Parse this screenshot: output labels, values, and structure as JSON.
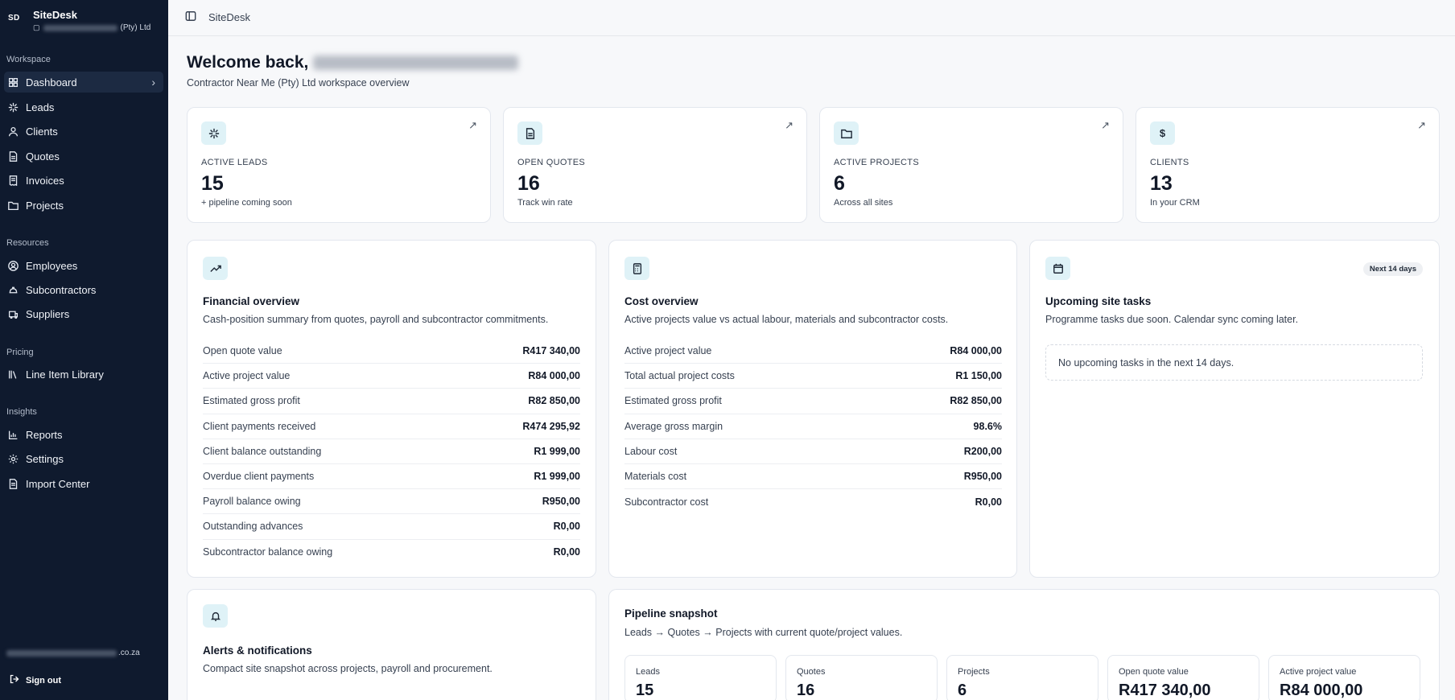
{
  "sidebar": {
    "badge": "SD",
    "app_name": "SiteDesk",
    "company_suffix": "(Pty) Ltd",
    "sections": {
      "workspace": "Workspace",
      "resources": "Resources",
      "pricing": "Pricing",
      "insights": "Insights"
    },
    "items": [
      {
        "label": "Dashboard",
        "icon": "grid-icon"
      },
      {
        "label": "Leads",
        "icon": "sparkle-icon"
      },
      {
        "label": "Clients",
        "icon": "user-icon"
      },
      {
        "label": "Quotes",
        "icon": "document-icon"
      },
      {
        "label": "Invoices",
        "icon": "receipt-icon"
      },
      {
        "label": "Projects",
        "icon": "folder-icon"
      },
      {
        "label": "Employees",
        "icon": "user-circle-icon"
      },
      {
        "label": "Subcontractors",
        "icon": "hardhat-icon"
      },
      {
        "label": "Suppliers",
        "icon": "package-icon"
      },
      {
        "label": "Line Item Library",
        "icon": "library-icon"
      },
      {
        "label": "Reports",
        "icon": "bar-chart-icon"
      },
      {
        "label": "Settings",
        "icon": "gear-icon"
      },
      {
        "label": "Import Center",
        "icon": "import-icon"
      }
    ],
    "email_suffix": ".co.za",
    "signout": "Sign out"
  },
  "topbar": {
    "title": "SiteDesk"
  },
  "header": {
    "welcome": "Welcome back,",
    "subtitle": "Contractor Near Me (Pty) Ltd workspace overview"
  },
  "stats": [
    {
      "label": "ACTIVE LEADS",
      "value": "15",
      "note": "+ pipeline coming soon",
      "icon": "sparkle-icon"
    },
    {
      "label": "OPEN QUOTES",
      "value": "16",
      "note": "Track win rate",
      "icon": "document-icon"
    },
    {
      "label": "ACTIVE PROJECTS",
      "value": "6",
      "note": "Across all sites",
      "icon": "folder-icon"
    },
    {
      "label": "CLIENTS",
      "value": "13",
      "note": "In your CRM",
      "icon": "dollar-icon"
    }
  ],
  "financial": {
    "title": "Financial overview",
    "desc": "Cash-position summary from quotes, payroll and subcontractor commitments.",
    "rows": [
      {
        "label": "Open quote value",
        "value": "R417 340,00"
      },
      {
        "label": "Active project value",
        "value": "R84 000,00"
      },
      {
        "label": "Estimated gross profit",
        "value": "R82 850,00"
      },
      {
        "label": "Client payments received",
        "value": "R474 295,92"
      },
      {
        "label": "Client balance outstanding",
        "value": "R1 999,00"
      },
      {
        "label": "Overdue client payments",
        "value": "R1 999,00"
      },
      {
        "label": "Payroll balance owing",
        "value": "R950,00"
      },
      {
        "label": "Outstanding advances",
        "value": "R0,00"
      },
      {
        "label": "Subcontractor balance owing",
        "value": "R0,00"
      }
    ]
  },
  "cost": {
    "title": "Cost overview",
    "desc": "Active projects value vs actual labour, materials and subcontractor costs.",
    "rows": [
      {
        "label": "Active project value",
        "value": "R84 000,00"
      },
      {
        "label": "Total actual project costs",
        "value": "R1 150,00"
      },
      {
        "label": "Estimated gross profit",
        "value": "R82 850,00"
      },
      {
        "label": "Average gross margin",
        "value": "98.6%"
      },
      {
        "label": "Labour cost",
        "value": "R200,00"
      },
      {
        "label": "Materials cost",
        "value": "R950,00"
      },
      {
        "label": "Subcontractor cost",
        "value": "R0,00"
      }
    ]
  },
  "tasks": {
    "title": "Upcoming site tasks",
    "badge": "Next 14 days",
    "desc": "Programme tasks due soon. Calendar sync coming later.",
    "empty": "No upcoming tasks in the next 14 days."
  },
  "alerts": {
    "title": "Alerts & notifications",
    "desc": "Compact site snapshot across projects, payroll and procurement."
  },
  "pipeline": {
    "title": "Pipeline snapshot",
    "desc": "Leads → Quotes → Projects with current quote/project values.",
    "items": [
      {
        "label": "Leads",
        "value": "15"
      },
      {
        "label": "Quotes",
        "value": "16"
      },
      {
        "label": "Projects",
        "value": "6"
      },
      {
        "label": "Open quote value",
        "value": "R417 340,00"
      },
      {
        "label": "Active project value",
        "value": "R84 000,00"
      }
    ]
  }
}
